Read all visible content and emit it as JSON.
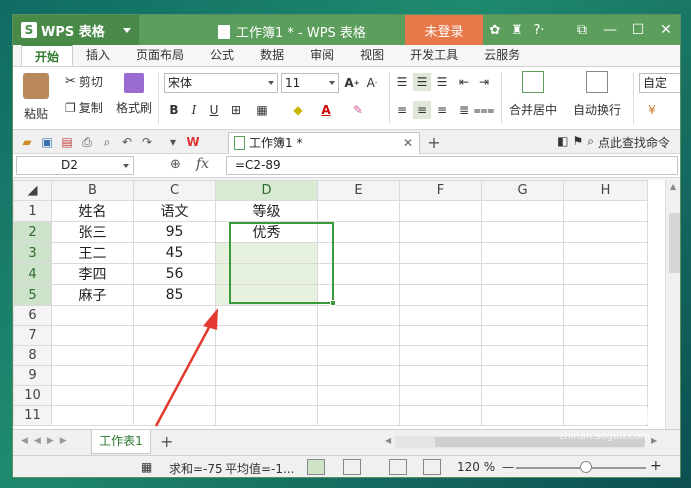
{
  "titlebar": {
    "app_name": "WPS 表格",
    "doc_title": "工作簿1 * - WPS 表格",
    "login": "未登录",
    "help": "?·"
  },
  "tabs": [
    "开始",
    "插入",
    "页面布局",
    "公式",
    "数据",
    "审阅",
    "视图",
    "开发工具",
    "云服务"
  ],
  "ribbon": {
    "paste": "粘贴",
    "cut": "剪切",
    "copy": "复制",
    "format_painter": "格式刷",
    "font_name": "宋体",
    "font_size": "11",
    "merge_center": "合并居中",
    "wrap_text": "自动换行",
    "custom": "自定",
    "bold": "B",
    "italic": "I",
    "underline": "U"
  },
  "quickbar": {
    "doc_tab": "工作簿1 *",
    "search_cmd": "点此查找命令"
  },
  "formula_bar": {
    "name_box": "D2",
    "fx": "fx",
    "formula": "=C2-89"
  },
  "sheet": {
    "columns": [
      "B",
      "C",
      "D",
      "E",
      "F",
      "G",
      "H"
    ],
    "rows": [
      {
        "n": "1",
        "cells": [
          "姓名",
          "语文",
          "等级",
          "",
          "",
          "",
          ""
        ]
      },
      {
        "n": "2",
        "cells": [
          "张三",
          "95",
          "优秀",
          "",
          "",
          "",
          ""
        ]
      },
      {
        "n": "3",
        "cells": [
          "王二",
          "45",
          "",
          "",
          "",
          "",
          ""
        ]
      },
      {
        "n": "4",
        "cells": [
          "李四",
          "56",
          "",
          "",
          "",
          "",
          ""
        ]
      },
      {
        "n": "5",
        "cells": [
          "麻子",
          "85",
          "",
          "",
          "",
          "",
          ""
        ]
      },
      {
        "n": "6",
        "cells": [
          "",
          "",
          "",
          "",
          "",
          "",
          ""
        ]
      },
      {
        "n": "7",
        "cells": [
          "",
          "",
          "",
          "",
          "",
          "",
          ""
        ]
      },
      {
        "n": "8",
        "cells": [
          "",
          "",
          "",
          "",
          "",
          "",
          ""
        ]
      },
      {
        "n": "9",
        "cells": [
          "",
          "",
          "",
          "",
          "",
          "",
          ""
        ]
      },
      {
        "n": "10",
        "cells": [
          "",
          "",
          "",
          "",
          "",
          "",
          ""
        ]
      },
      {
        "n": "11",
        "cells": [
          "",
          "",
          "",
          "",
          "",
          "",
          ""
        ]
      }
    ]
  },
  "sheet_tabs": {
    "active": "工作表1",
    "add": "+"
  },
  "statusbar": {
    "sum": "求和=-75",
    "avg": "平均值=-1...",
    "zoom": "120 %",
    "minus": "—",
    "plus": "+"
  },
  "watermark": {
    "brand": "搜狗指南",
    "url": "zhinan.sogou.com"
  },
  "colors": {
    "titlebar": "#5c9e5c",
    "accent": "#3a9a3a",
    "login": "#e8774a",
    "annotation_arrow": "#e23a2e"
  }
}
